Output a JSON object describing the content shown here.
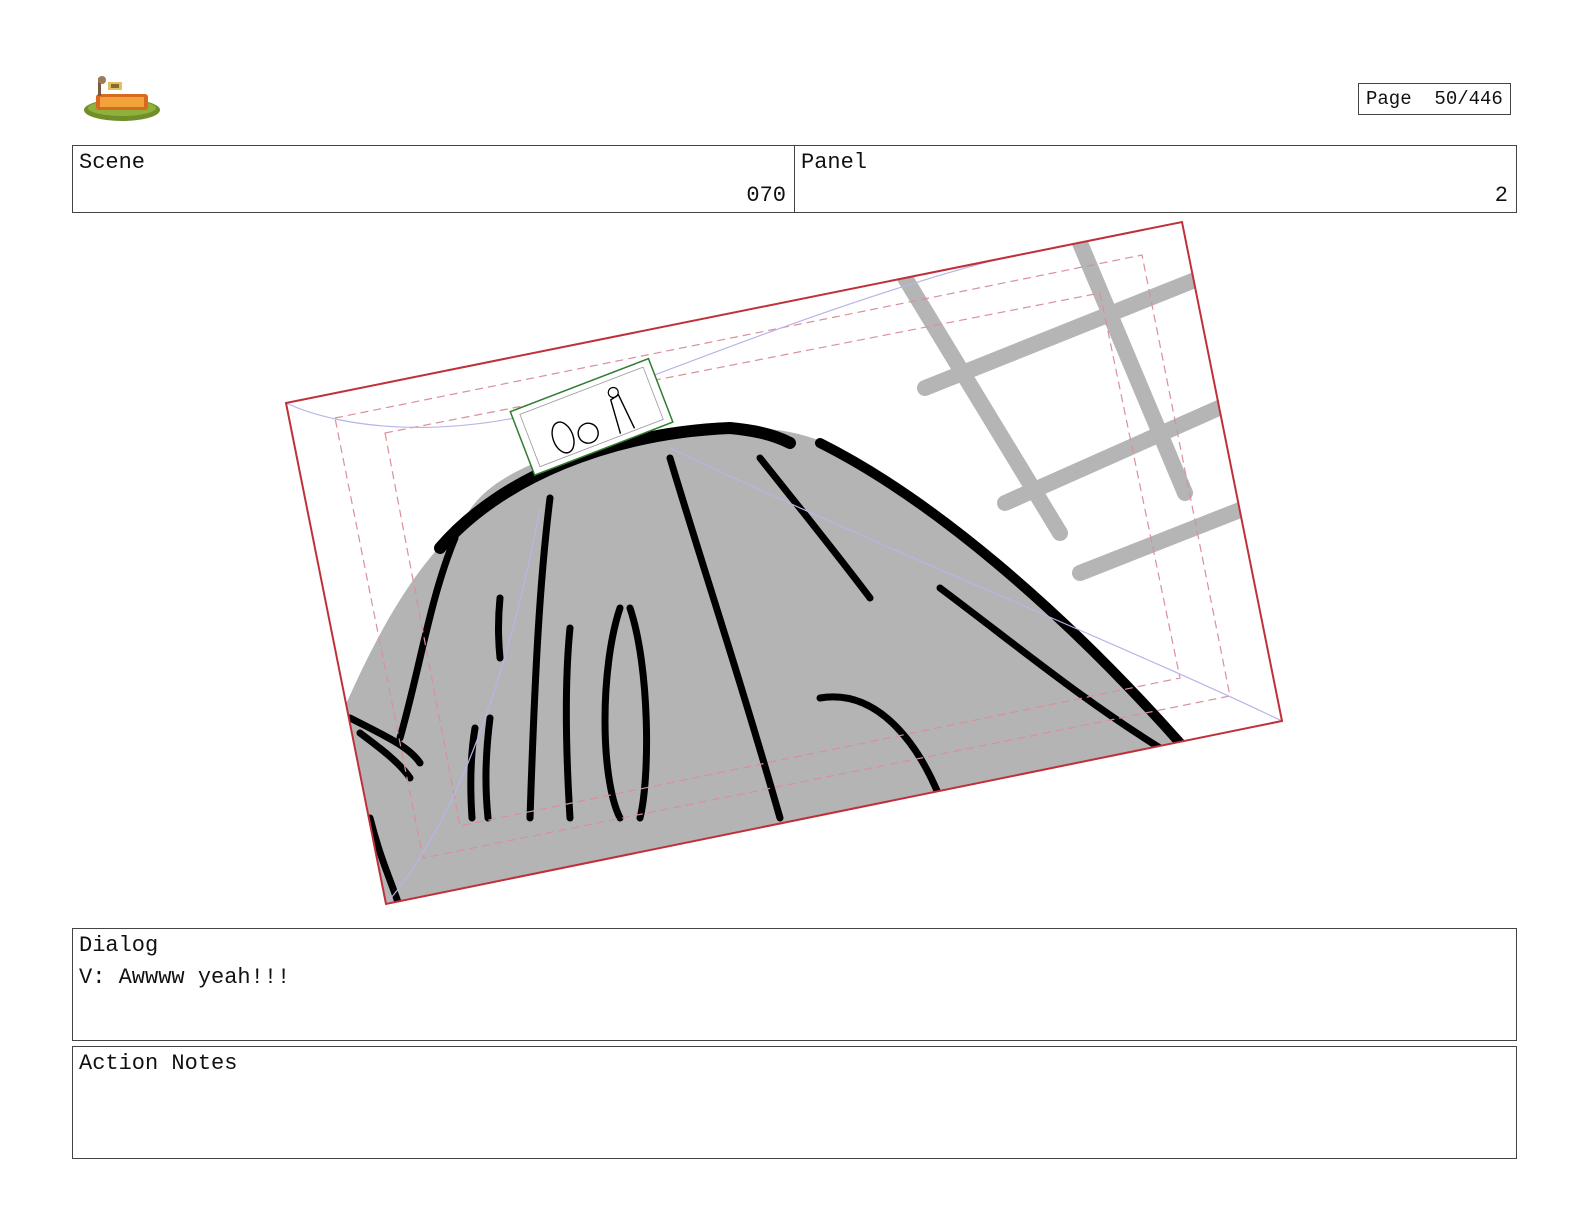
{
  "header": {
    "logo_icon": "show-logo-grass-sign",
    "page_label": "Page",
    "page_value": "50/446"
  },
  "scene": {
    "label": "Scene",
    "value": "070"
  },
  "panel": {
    "label": "Panel",
    "value": "2"
  },
  "artwork": {
    "description_icon": "storyboard-sketch-rock-mound-with-characters",
    "frame_color": "#c0303a",
    "safe_area_color": "#d9909a",
    "guide_color": "#b8b4e8",
    "inset_frame_color": "#2f7d2f"
  },
  "dialog": {
    "label": "Dialog",
    "text": "V: Awwww yeah!!!"
  },
  "action_notes": {
    "label": "Action Notes",
    "text": ""
  }
}
